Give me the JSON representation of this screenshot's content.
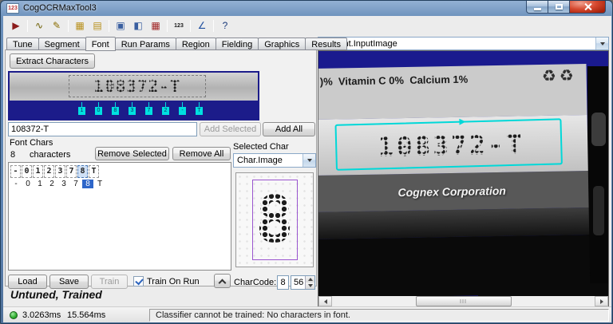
{
  "window": {
    "title": "CogOCRMaxTool3",
    "icon_text": "123"
  },
  "toolbar": {
    "icons": [
      {
        "name": "run",
        "glyph": "▶",
        "color": "#8b1c1c"
      },
      {
        "name": "separator"
      },
      {
        "name": "electric-connect",
        "glyph": "∿",
        "color": "#6b5d00"
      },
      {
        "name": "edit-graphics",
        "glyph": "✎",
        "color": "#8a6d00"
      },
      {
        "name": "separator"
      },
      {
        "name": "current-record-grid",
        "glyph": "▦",
        "color": "#b8901c"
      },
      {
        "name": "last-run-record-grid",
        "glyph": "▤",
        "color": "#b8901c"
      },
      {
        "name": "separator"
      },
      {
        "name": "open-file",
        "glyph": "▣",
        "color": "#3a5fa0"
      },
      {
        "name": "save-file",
        "glyph": "◧",
        "color": "#3a5fa0"
      },
      {
        "name": "buffer-grid",
        "glyph": "▦",
        "color": "#a02525"
      },
      {
        "name": "separator"
      },
      {
        "name": "numbers-123",
        "glyph": "123",
        "color": "#1a1a1a",
        "small": true
      },
      {
        "name": "separator"
      },
      {
        "name": "measure-angle",
        "glyph": "∠",
        "color": "#2050a0"
      },
      {
        "name": "separator"
      },
      {
        "name": "help",
        "glyph": "?",
        "color": "#1a3a7a"
      }
    ]
  },
  "tabs": {
    "items": [
      "Tune",
      "Segment",
      "Font",
      "Run Params",
      "Region",
      "Fielding",
      "Graphics",
      "Results"
    ],
    "active": "Font"
  },
  "image_combo": {
    "value": "Current.InputImage"
  },
  "font_tab": {
    "extract_button": "Extract Characters",
    "strip_text": "108372-T",
    "strip_chars": [
      "1",
      "0",
      "8",
      "3",
      "7",
      "2",
      "-",
      "T"
    ],
    "extracted_text": "108372-T",
    "add_selected_button": "Add Selected",
    "add_all_button": "Add All",
    "font_chars_label": "Font Chars",
    "char_count": "8",
    "characters_word": "characters",
    "remove_selected_button": "Remove Selected",
    "remove_all_button": "Remove All",
    "selected_char_label": "Selected Char",
    "char_image_combo": "Char.Image",
    "chars": [
      "-",
      "0",
      "1",
      "2",
      "3",
      "7",
      "8",
      "T"
    ],
    "selected_index": 6,
    "preview_char": "8",
    "load_button": "Load",
    "save_button": "Save",
    "train_button": "Train",
    "train_on_run_label": "Train On Run",
    "train_on_run_checked": true,
    "charcode_label": "CharCode:",
    "charcode_char": "8",
    "charcode_value": "56"
  },
  "right_image": {
    "nutrition_text": ")%  Vitamin C 0%  Calcium 1%",
    "recycle_icons": "♻♻",
    "ocr_text": "108372-T",
    "brand_text": "Cognex Corporation"
  },
  "status": {
    "tool_state": "Untuned, Trained",
    "time_1": "3.0263ms",
    "time_2": "15.564ms",
    "message": "Classifier cannot be trained: No characters in font."
  }
}
